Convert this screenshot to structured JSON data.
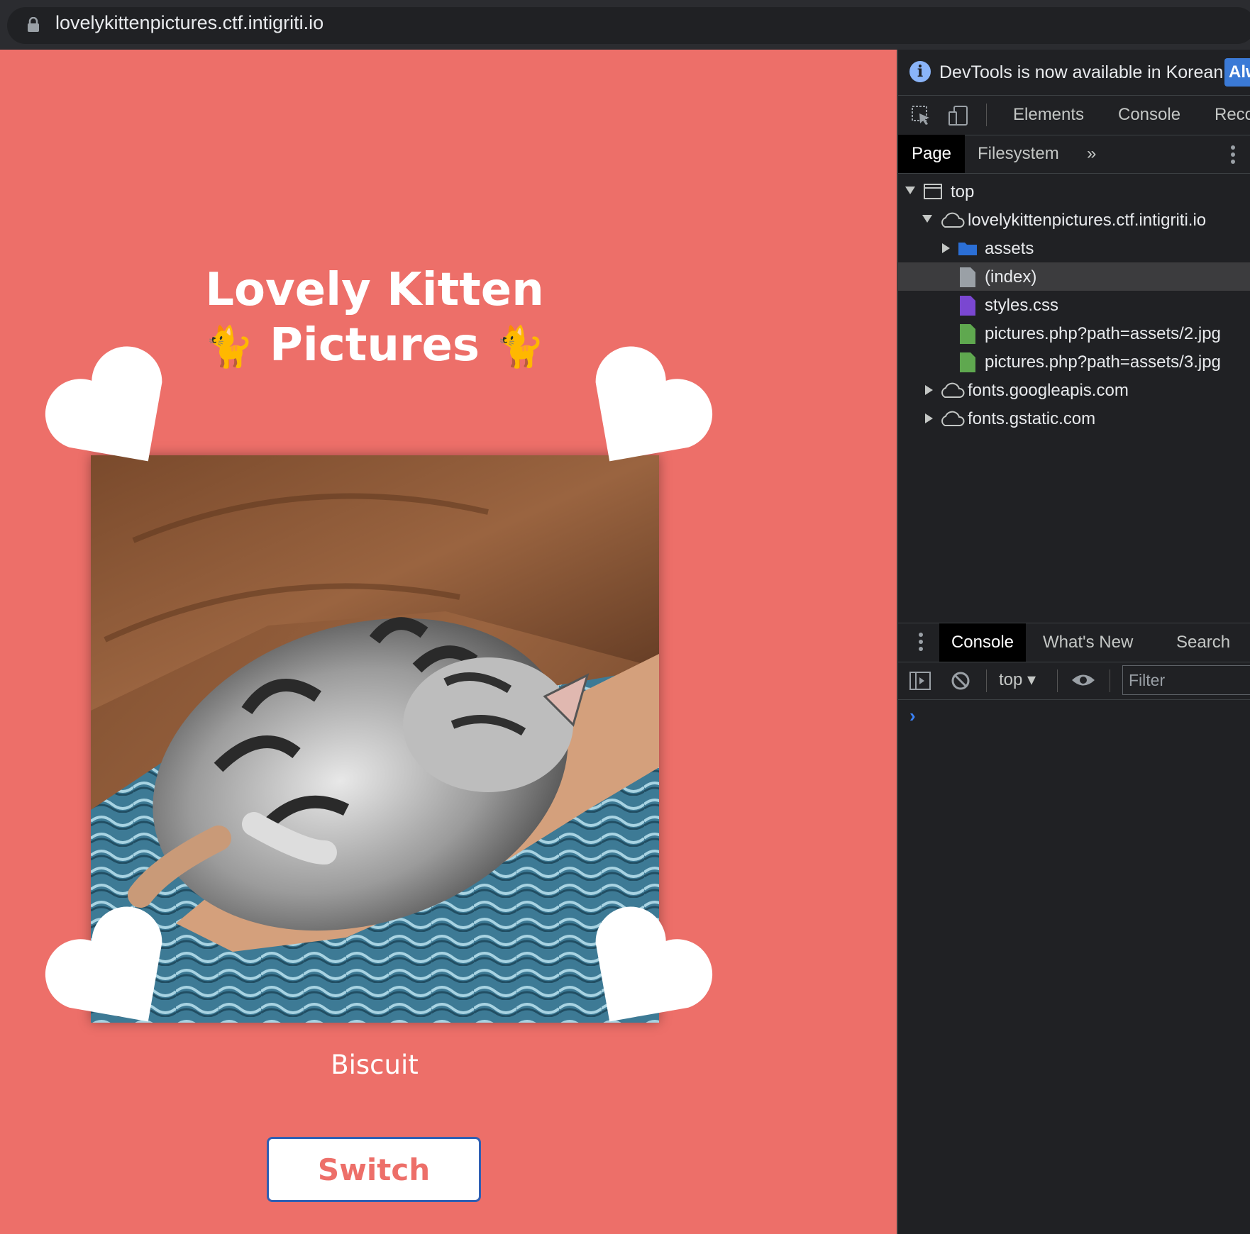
{
  "browser": {
    "url": "lovelykittenpictures.ctf.intigriti.io"
  },
  "page": {
    "title_line1": "Lovely Kitten",
    "title_line2": "Pictures",
    "title_emoji": "🐈",
    "caption": "Biscuit",
    "switch_label": "Switch",
    "background_color": "#ed6f69"
  },
  "devtools": {
    "info_message": "DevTools is now available in Korean!",
    "info_button": "Alw",
    "main_tabs": [
      "Elements",
      "Console",
      "Reco"
    ],
    "sub_tabs": {
      "active": "Page",
      "other": "Filesystem",
      "more": "»"
    },
    "tree": {
      "top": "top",
      "domain": "lovelykittenpictures.ctf.intigriti.io",
      "assets": "assets",
      "index": "(index)",
      "styles": "styles.css",
      "pic2": "pictures.php?path=assets/2.jpg",
      "pic3": "pictures.php?path=assets/3.jpg",
      "googleapis": "fonts.googleapis.com",
      "gstatic": "fonts.gstatic.com"
    },
    "drawer_tabs": {
      "active": "Console",
      "whats_new": "What's New",
      "search": "Search"
    },
    "console": {
      "context": "top",
      "filter_placeholder": "Filter",
      "prompt": "›"
    }
  }
}
